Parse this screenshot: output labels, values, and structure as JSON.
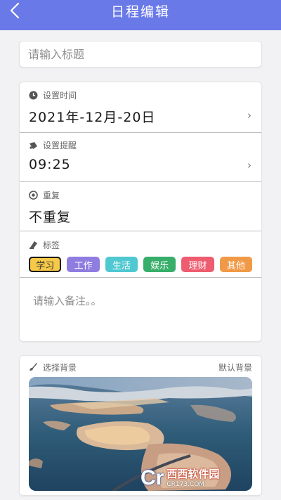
{
  "header": {
    "title": "日程编辑"
  },
  "title_input": {
    "placeholder": "请输入标题"
  },
  "time": {
    "label": "设置时间",
    "value": "2021年-12月-20日",
    "chevron": "›"
  },
  "reminder": {
    "label": "设置提醒",
    "value": "09:25",
    "chevron": "›"
  },
  "repeat": {
    "label": "重复",
    "value": "不重复"
  },
  "tags": {
    "label": "标签",
    "items": [
      {
        "label": "学习",
        "color": "#f7c948",
        "selected": true
      },
      {
        "label": "工作",
        "color": "#8f7ee0"
      },
      {
        "label": "生活",
        "color": "#4fc8d2"
      },
      {
        "label": "娱乐",
        "color": "#37ae6a"
      },
      {
        "label": "理财",
        "color": "#ee5c6f"
      },
      {
        "label": "其他",
        "color": "#f09a47"
      }
    ]
  },
  "notes": {
    "placeholder": "请输入备注。。"
  },
  "background": {
    "label": "选择背景",
    "default_label": "默认背景"
  },
  "watermark": {
    "logo": "Cr",
    "text": "西西软件园",
    "sub": "CR173.COM"
  },
  "colors": {
    "header": "#6a79e8"
  },
  "icons": [
    "back-arrow-icon",
    "clock-icon",
    "bell-icon",
    "repeat-icon",
    "tag-icon",
    "brush-icon",
    "chevron-right-icon"
  ]
}
